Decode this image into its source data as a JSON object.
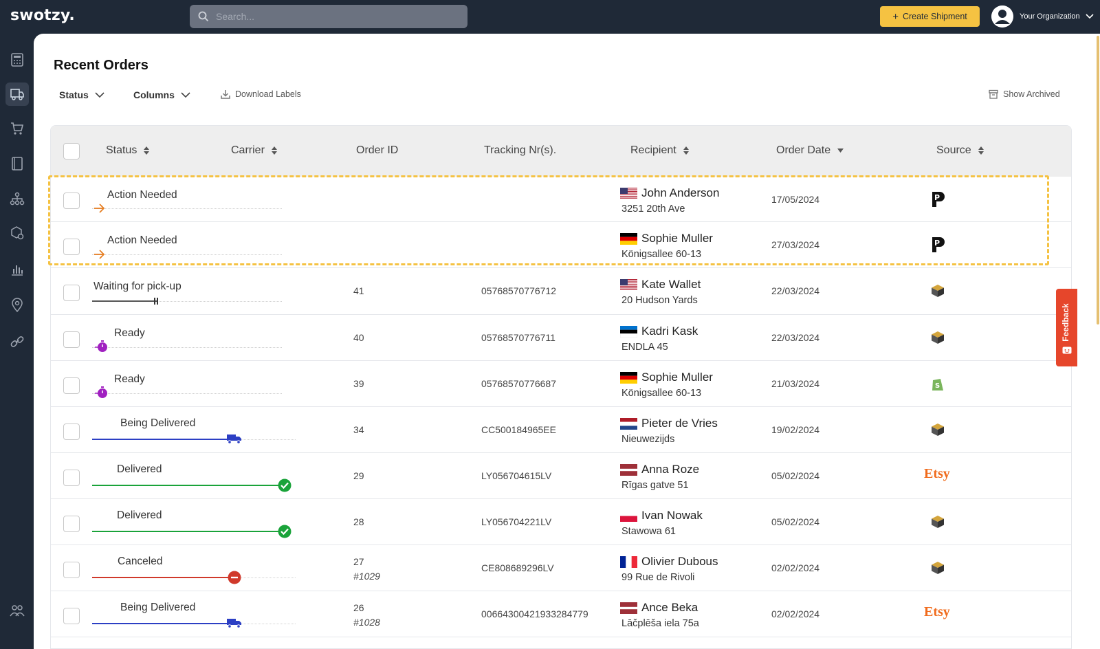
{
  "app": {
    "logo": "swotzy."
  },
  "search": {
    "placeholder": "Search..."
  },
  "header": {
    "create_label": "Create Shipment",
    "org_label": "Your Organization"
  },
  "page": {
    "title": "Recent Orders"
  },
  "toolbar": {
    "status_label": "Status",
    "columns_label": "Columns",
    "download_label": "Download Labels",
    "archived_label": "Show Archived"
  },
  "columns": {
    "status": "Status",
    "carrier": "Carrier",
    "order_id": "Order ID",
    "tracking": "Tracking Nr(s).",
    "recipient": "Recipient",
    "order_date": "Order Date",
    "source": "Source"
  },
  "feedback": {
    "label": "Feedback"
  },
  "sidebar": {
    "icons": [
      "calculator-icon",
      "shipments-icon",
      "cart-icon",
      "book-icon",
      "network-icon",
      "box-settings-icon",
      "chart-icon",
      "location-icon",
      "link-icon",
      "users-icon"
    ]
  },
  "colors": {
    "accent": "#f5c242",
    "action": "#e67e22",
    "ready": "#a020c0",
    "delivering": "#2c3fc4",
    "delivered": "#1aa33a",
    "canceled": "#d0392b",
    "feedback": "#e6462b"
  },
  "orders": [
    {
      "status": "Action Needed",
      "status_kind": "action",
      "progress": 0,
      "order_id": "",
      "order_ref": "",
      "tracking": "",
      "recipient_name": "John Anderson",
      "recipient_address": "3251 20th Ave",
      "country": "US",
      "order_date": "17/05/2024",
      "source": "P",
      "source_kind": "parcel"
    },
    {
      "status": "Action Needed",
      "status_kind": "action",
      "progress": 0,
      "order_id": "",
      "order_ref": "",
      "tracking": "",
      "recipient_name": "Sophie Muller",
      "recipient_address": "Königsallee 60-13",
      "country": "DE",
      "order_date": "27/03/2024",
      "source": "P",
      "source_kind": "parcel"
    },
    {
      "status": "Waiting for pick-up",
      "status_kind": "waiting",
      "progress": 0.3,
      "order_id": "41",
      "order_ref": "",
      "tracking": "05768570776712",
      "recipient_name": "Kate Wallet",
      "recipient_address": "20 Hudson Yards",
      "country": "US",
      "order_date": "22/03/2024",
      "source": "",
      "source_kind": "box"
    },
    {
      "status": "Ready",
      "status_kind": "ready",
      "progress": 0,
      "order_id": "40",
      "order_ref": "",
      "tracking": "05768570776711",
      "recipient_name": "Kadri Kask",
      "recipient_address": "ENDLA 45",
      "country": "EE",
      "order_date": "22/03/2024",
      "source": "",
      "source_kind": "box"
    },
    {
      "status": "Ready",
      "status_kind": "ready",
      "progress": 0,
      "order_id": "39",
      "order_ref": "",
      "tracking": "05768570776687",
      "recipient_name": "Sophie Muller",
      "recipient_address": "Königsallee 60-13",
      "country": "DE",
      "order_date": "21/03/2024",
      "source": "",
      "source_kind": "shopify"
    },
    {
      "status": "Being Delivered",
      "status_kind": "delivering",
      "progress": 0.7,
      "order_id": "34",
      "order_ref": "",
      "tracking": "CC500184965EE",
      "recipient_name": "Pieter de Vries",
      "recipient_address": "Nieuwezijds",
      "country": "NL",
      "order_date": "19/02/2024",
      "source": "",
      "source_kind": "box"
    },
    {
      "status": "Delivered",
      "status_kind": "delivered",
      "progress": 1,
      "order_id": "29",
      "order_ref": "",
      "tracking": "LY056704615LV",
      "recipient_name": "Anna Roze",
      "recipient_address": "Rīgas gatve 51",
      "country": "LV",
      "order_date": "05/02/2024",
      "source": "Etsy",
      "source_kind": "etsy"
    },
    {
      "status": "Delivered",
      "status_kind": "delivered",
      "progress": 1,
      "order_id": "28",
      "order_ref": "",
      "tracking": "LY056704221LV",
      "recipient_name": "Ivan Nowak",
      "recipient_address": "Stawowa 61",
      "country": "PL",
      "order_date": "05/02/2024",
      "source": "",
      "source_kind": "box"
    },
    {
      "status": "Canceled",
      "status_kind": "canceled",
      "progress": 0.7,
      "order_id": "27",
      "order_ref": "#1029",
      "tracking": "CE808689296LV",
      "recipient_name": "Olivier Dubous",
      "recipient_address": "99 Rue de Rivoli",
      "country": "FR",
      "order_date": "02/02/2024",
      "source": "",
      "source_kind": "box"
    },
    {
      "status": "Being Delivered",
      "status_kind": "delivering",
      "progress": 0.7,
      "order_id": "26",
      "order_ref": "#1028",
      "tracking": "00664300421933284779",
      "recipient_name": "Ance Beka",
      "recipient_address": "Lāčplēša iela 75a",
      "country": "LV",
      "order_date": "02/02/2024",
      "source": "Etsy",
      "source_kind": "etsy"
    }
  ]
}
